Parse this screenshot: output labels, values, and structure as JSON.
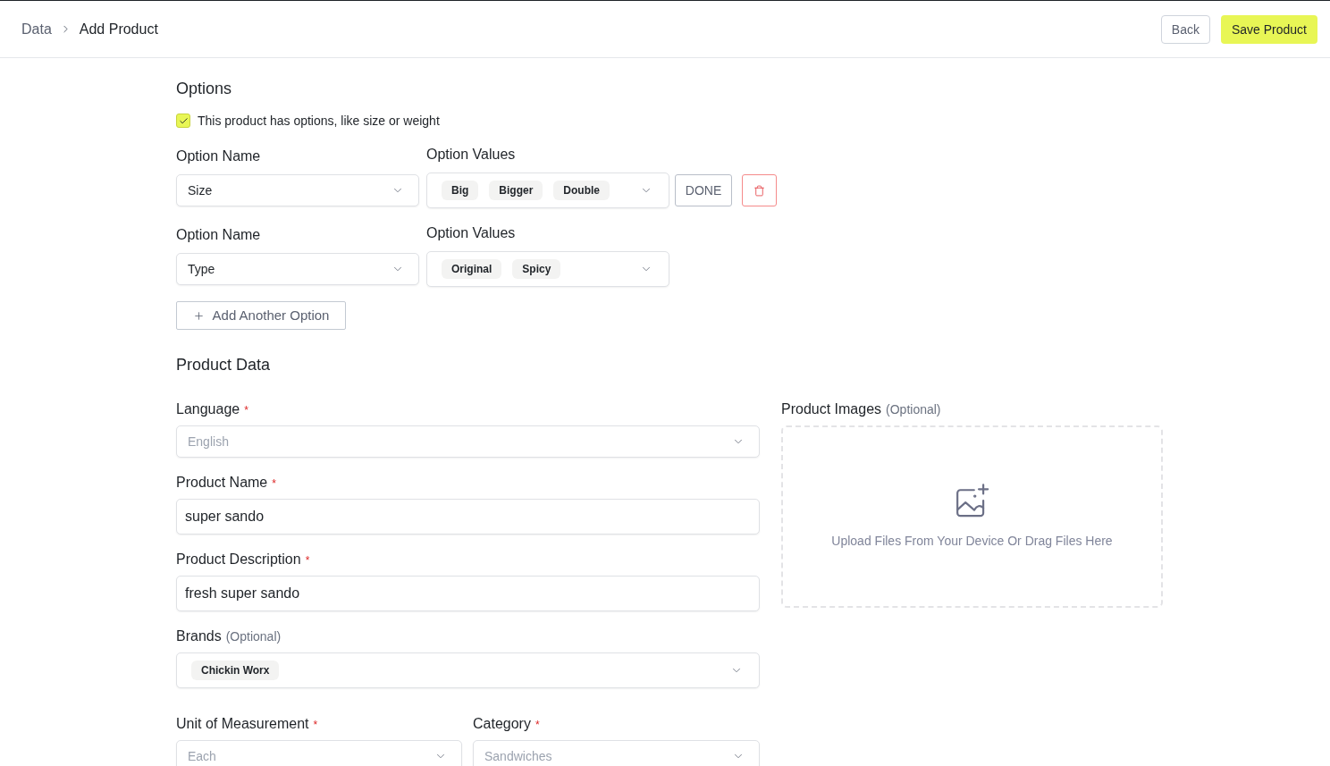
{
  "breadcrumb": [
    {
      "label": "Data",
      "current": false
    },
    {
      "label": "Add Product",
      "current": true
    }
  ],
  "actions": [
    {
      "kind": "secondary",
      "label": "Back"
    },
    {
      "kind": "primary",
      "label": "Save Product"
    }
  ],
  "options": {
    "title": "Options",
    "has_options": {
      "label": "This product has options, like size or weight",
      "checked": true
    },
    "rows": [
      {
        "name_label": "Option Name",
        "name": "Size",
        "values_label": "Option Values",
        "values": [
          "Big",
          "Bigger",
          "Double"
        ],
        "editing": true,
        "done_label": "DONE"
      },
      {
        "name_label": "Option Name",
        "name": "Type",
        "values_label": "Option Values",
        "values": [
          "Original",
          "Spicy"
        ],
        "editing": false
      }
    ],
    "add_button": "Add Another Option"
  },
  "product_data": {
    "title": "Product Data",
    "fields": [
      {
        "kind": "select",
        "label": "Language",
        "required_mark": "*",
        "placeholder": "English"
      },
      {
        "kind": "text",
        "label": "Product Name",
        "required_mark": "*",
        "value": "super sando"
      },
      {
        "kind": "text",
        "label": "Product Description",
        "required_mark": "*",
        "value": "fresh super sando"
      },
      {
        "kind": "tags",
        "label": "Brands",
        "note": "(Optional)",
        "values": [
          "Chickin Worx"
        ]
      }
    ],
    "pair_fields": [
      {
        "kind": "select",
        "label": "Unit of Measurement",
        "required_mark": "*",
        "placeholder": "Each"
      },
      {
        "kind": "select",
        "label": "Category",
        "required_mark": "*",
        "placeholder": "Sandwiches"
      }
    ],
    "images": {
      "label": "Product Images",
      "note": "(Optional)",
      "hint": "Upload Files From Your Device Or Drag Files Here"
    }
  }
}
